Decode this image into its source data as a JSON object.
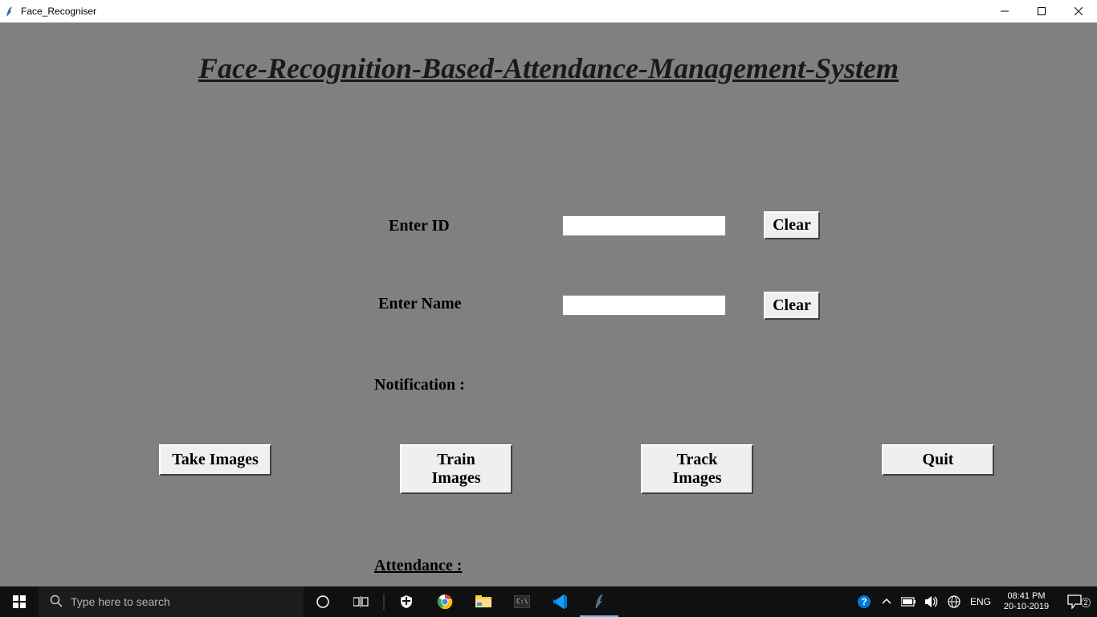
{
  "window": {
    "title": "Face_Recogniser"
  },
  "app": {
    "heading": "Face-Recognition-Based-Attendance-Management-System",
    "labels": {
      "id": "Enter ID",
      "name": "Enter Name",
      "notification": "Notification :",
      "attendance": "Attendance : "
    },
    "values": {
      "id": "",
      "name": ""
    },
    "buttons": {
      "clear_id": "Clear",
      "clear_name": "Clear",
      "take": "Take Images",
      "train": "Train Images",
      "track": "Track Images",
      "quit": "Quit"
    }
  },
  "taskbar": {
    "search_placeholder": "Type here to search",
    "lang": "ENG",
    "time": "08:41 PM",
    "date": "20-10-2019",
    "notifications_count": "2"
  }
}
